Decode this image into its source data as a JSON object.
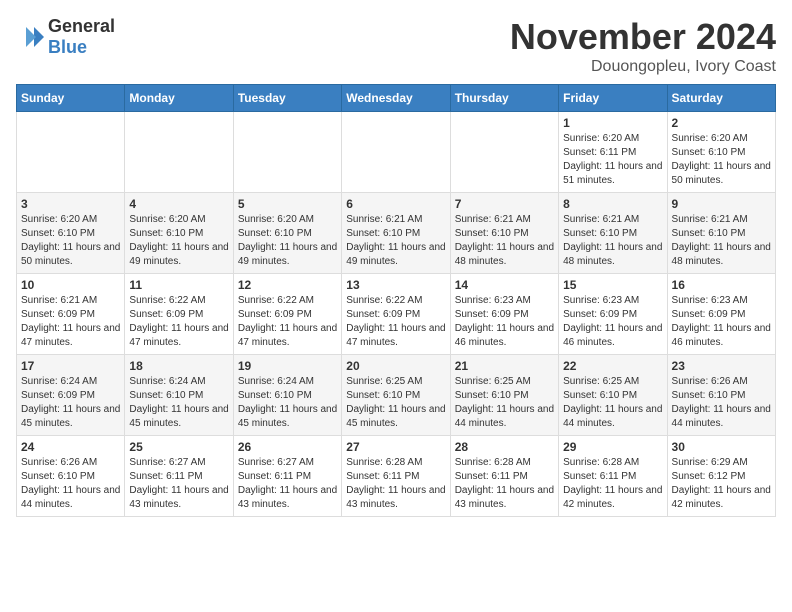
{
  "header": {
    "logo_general": "General",
    "logo_blue": "Blue",
    "month": "November 2024",
    "location": "Douongopleu, Ivory Coast"
  },
  "days_of_week": [
    "Sunday",
    "Monday",
    "Tuesday",
    "Wednesday",
    "Thursday",
    "Friday",
    "Saturday"
  ],
  "weeks": [
    [
      {
        "day": "",
        "info": ""
      },
      {
        "day": "",
        "info": ""
      },
      {
        "day": "",
        "info": ""
      },
      {
        "day": "",
        "info": ""
      },
      {
        "day": "",
        "info": ""
      },
      {
        "day": "1",
        "info": "Sunrise: 6:20 AM\nSunset: 6:11 PM\nDaylight: 11 hours and 51 minutes."
      },
      {
        "day": "2",
        "info": "Sunrise: 6:20 AM\nSunset: 6:10 PM\nDaylight: 11 hours and 50 minutes."
      }
    ],
    [
      {
        "day": "3",
        "info": "Sunrise: 6:20 AM\nSunset: 6:10 PM\nDaylight: 11 hours and 50 minutes."
      },
      {
        "day": "4",
        "info": "Sunrise: 6:20 AM\nSunset: 6:10 PM\nDaylight: 11 hours and 49 minutes."
      },
      {
        "day": "5",
        "info": "Sunrise: 6:20 AM\nSunset: 6:10 PM\nDaylight: 11 hours and 49 minutes."
      },
      {
        "day": "6",
        "info": "Sunrise: 6:21 AM\nSunset: 6:10 PM\nDaylight: 11 hours and 49 minutes."
      },
      {
        "day": "7",
        "info": "Sunrise: 6:21 AM\nSunset: 6:10 PM\nDaylight: 11 hours and 48 minutes."
      },
      {
        "day": "8",
        "info": "Sunrise: 6:21 AM\nSunset: 6:10 PM\nDaylight: 11 hours and 48 minutes."
      },
      {
        "day": "9",
        "info": "Sunrise: 6:21 AM\nSunset: 6:10 PM\nDaylight: 11 hours and 48 minutes."
      }
    ],
    [
      {
        "day": "10",
        "info": "Sunrise: 6:21 AM\nSunset: 6:09 PM\nDaylight: 11 hours and 47 minutes."
      },
      {
        "day": "11",
        "info": "Sunrise: 6:22 AM\nSunset: 6:09 PM\nDaylight: 11 hours and 47 minutes."
      },
      {
        "day": "12",
        "info": "Sunrise: 6:22 AM\nSunset: 6:09 PM\nDaylight: 11 hours and 47 minutes."
      },
      {
        "day": "13",
        "info": "Sunrise: 6:22 AM\nSunset: 6:09 PM\nDaylight: 11 hours and 47 minutes."
      },
      {
        "day": "14",
        "info": "Sunrise: 6:23 AM\nSunset: 6:09 PM\nDaylight: 11 hours and 46 minutes."
      },
      {
        "day": "15",
        "info": "Sunrise: 6:23 AM\nSunset: 6:09 PM\nDaylight: 11 hours and 46 minutes."
      },
      {
        "day": "16",
        "info": "Sunrise: 6:23 AM\nSunset: 6:09 PM\nDaylight: 11 hours and 46 minutes."
      }
    ],
    [
      {
        "day": "17",
        "info": "Sunrise: 6:24 AM\nSunset: 6:09 PM\nDaylight: 11 hours and 45 minutes."
      },
      {
        "day": "18",
        "info": "Sunrise: 6:24 AM\nSunset: 6:10 PM\nDaylight: 11 hours and 45 minutes."
      },
      {
        "day": "19",
        "info": "Sunrise: 6:24 AM\nSunset: 6:10 PM\nDaylight: 11 hours and 45 minutes."
      },
      {
        "day": "20",
        "info": "Sunrise: 6:25 AM\nSunset: 6:10 PM\nDaylight: 11 hours and 45 minutes."
      },
      {
        "day": "21",
        "info": "Sunrise: 6:25 AM\nSunset: 6:10 PM\nDaylight: 11 hours and 44 minutes."
      },
      {
        "day": "22",
        "info": "Sunrise: 6:25 AM\nSunset: 6:10 PM\nDaylight: 11 hours and 44 minutes."
      },
      {
        "day": "23",
        "info": "Sunrise: 6:26 AM\nSunset: 6:10 PM\nDaylight: 11 hours and 44 minutes."
      }
    ],
    [
      {
        "day": "24",
        "info": "Sunrise: 6:26 AM\nSunset: 6:10 PM\nDaylight: 11 hours and 44 minutes."
      },
      {
        "day": "25",
        "info": "Sunrise: 6:27 AM\nSunset: 6:11 PM\nDaylight: 11 hours and 43 minutes."
      },
      {
        "day": "26",
        "info": "Sunrise: 6:27 AM\nSunset: 6:11 PM\nDaylight: 11 hours and 43 minutes."
      },
      {
        "day": "27",
        "info": "Sunrise: 6:28 AM\nSunset: 6:11 PM\nDaylight: 11 hours and 43 minutes."
      },
      {
        "day": "28",
        "info": "Sunrise: 6:28 AM\nSunset: 6:11 PM\nDaylight: 11 hours and 43 minutes."
      },
      {
        "day": "29",
        "info": "Sunrise: 6:28 AM\nSunset: 6:11 PM\nDaylight: 11 hours and 42 minutes."
      },
      {
        "day": "30",
        "info": "Sunrise: 6:29 AM\nSunset: 6:12 PM\nDaylight: 11 hours and 42 minutes."
      }
    ]
  ]
}
